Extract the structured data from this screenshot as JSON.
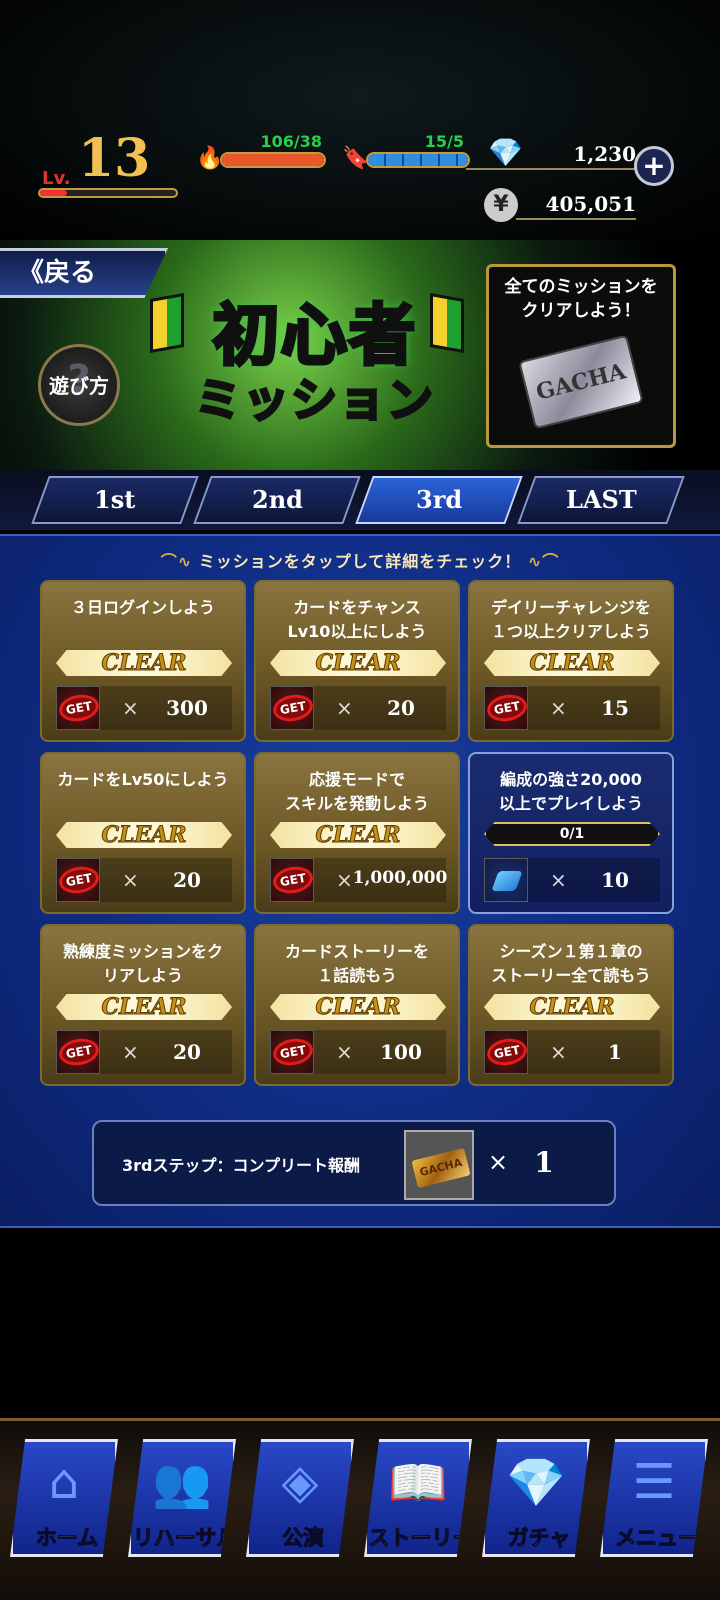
{
  "status": {
    "level_prefix": "Lv.",
    "level": "13",
    "stamina_a": "106/38",
    "stamina_b": "15/5",
    "gems": "1,230",
    "coins": "405,051",
    "plus": "+",
    "coin_symbol": "¥"
  },
  "banner": {
    "back": "戻る",
    "help": "遊び方",
    "title_main": "初心者",
    "title_sub": "ミッション",
    "reward_text_1": "全てのミッションを",
    "reward_text_2": "クリアしよう！",
    "ticket_text": "GACHA"
  },
  "tabs": [
    "1st",
    "2nd",
    "3rd",
    "LAST"
  ],
  "active_tab": "3rd",
  "hint": "ミッションをタップして詳細をチェック！",
  "missions": [
    {
      "title": "３日ログインしよう",
      "status": "CLEAR",
      "reward": "300",
      "icon": "gem-get"
    },
    {
      "title": "カードをチャンス\nLv10以上にしよう",
      "status": "CLEAR",
      "reward": "20",
      "icon": "gem-get"
    },
    {
      "title": "デイリーチャレンジを\n１つ以上クリアしよう",
      "status": "CLEAR",
      "reward": "15",
      "icon": "gem-get"
    },
    {
      "title": "カードをLv50にしよう",
      "status": "CLEAR",
      "reward": "20",
      "icon": "gem-get"
    },
    {
      "title": "応援モードで\nスキルを発動しよう",
      "status": "CLEAR",
      "reward": "1,000,000",
      "icon": "coin-get"
    },
    {
      "title": "編成の強さ20,000\n以上でプレイしよう",
      "progress": "0/1",
      "reward": "10",
      "icon": "shoe"
    },
    {
      "title": "熟練度ミッションをク\nリアしよう",
      "status": "CLEAR",
      "reward": "20",
      "icon": "gem-get"
    },
    {
      "title": "カードストーリーを\n１話読もう",
      "status": "CLEAR",
      "reward": "100",
      "icon": "gem-get"
    },
    {
      "title": "シーズン１第１章の\nストーリー全て読もう",
      "status": "CLEAR",
      "reward": "1",
      "icon": "card-get"
    }
  ],
  "get_label": "GET",
  "times": "×",
  "complete": {
    "label": "3rdステップ：コンプリート報酬",
    "times": "×",
    "qty": "1",
    "ticket_text": "GACHA"
  },
  "nav": [
    {
      "label": "ホーム",
      "icon": "home-icon",
      "glyph": "⌂"
    },
    {
      "label": "リハーサル",
      "icon": "rehearsal-icon",
      "glyph": "👥"
    },
    {
      "label": "公演",
      "icon": "stage-icon",
      "glyph": "◈"
    },
    {
      "label": "ストーリー",
      "icon": "story-icon",
      "glyph": "📖"
    },
    {
      "label": "ガチャ",
      "icon": "gacha-icon",
      "glyph": "💎"
    },
    {
      "label": "メニュー",
      "icon": "menu-icon",
      "glyph": "☰"
    }
  ],
  "colors": {
    "stamina_a": "#e8562a",
    "stamina_b": "#2f8ee0",
    "text_green": "#28d048",
    "accent_gold": "#e0b440"
  }
}
